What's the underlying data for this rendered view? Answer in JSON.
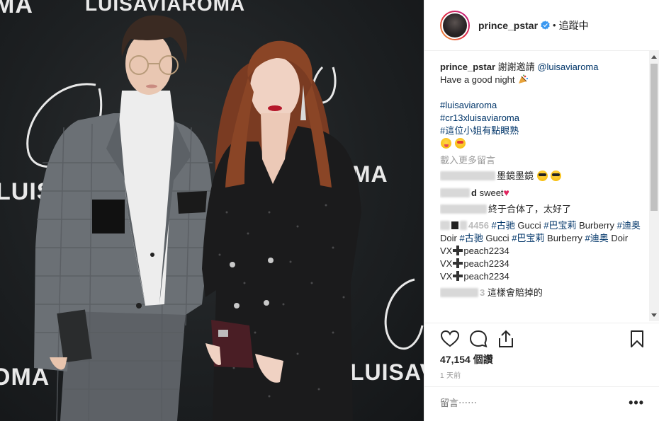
{
  "photo": {
    "backdrop_texts": [
      "MA",
      "LUISAVIAROMA",
      "LUISAV",
      "OMA",
      "OMA",
      "LUISAV"
    ]
  },
  "header": {
    "username": "prince_pstar",
    "dot": "•",
    "follow_status": "追蹤中"
  },
  "caption": {
    "username": "prince_pstar",
    "text": "謝謝邀請",
    "mention": "@luisaviaroma",
    "line2": "Have a good night",
    "hashtags": [
      "#luisaviaroma",
      "#cr13xluisaviaroma",
      "#這位小姐有點眼熟"
    ]
  },
  "load_more": "載入更多留言",
  "comments": [
    {
      "visible_username": "",
      "text": "墨鏡墨鏡"
    },
    {
      "visible_username": "d",
      "text": "sweet"
    },
    {
      "visible_username": "",
      "text": "終于合体了，太好了"
    },
    {
      "visible_username": "4456",
      "text_parts": [
        "#古驰",
        "Gucci",
        "#巴宝莉",
        "Burberry",
        "#迪奥",
        "Doir",
        "#古驰",
        "Gucci",
        "#巴宝莉",
        "Burberry",
        "#迪奥",
        "Doir"
      ],
      "vx_lines": [
        "VX",
        "peach2234",
        "VX",
        "peach2234",
        "VX",
        "peach2234"
      ]
    },
    {
      "visible_username": "3",
      "text": "這樣會賠掉的"
    }
  ],
  "likes_count": "47,154",
  "likes_unit": "個讚",
  "timestamp": "1 天前",
  "comment_placeholder": "留言⋯⋯",
  "more_options": "•••",
  "colors": {
    "link": "#003569",
    "verified": "#3897f0",
    "heart": "#e0245e"
  }
}
